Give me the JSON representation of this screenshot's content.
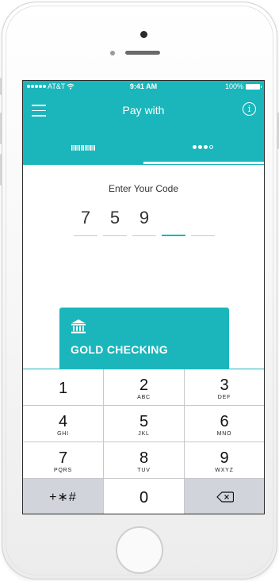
{
  "status_bar": {
    "carrier": "AT&T",
    "time": "9:41 AM",
    "battery": "100%"
  },
  "nav": {
    "title": "Pay with",
    "menu_icon": "hamburger-menu-icon",
    "info_icon": "info-icon",
    "info_glyph": "i"
  },
  "tabs": [
    {
      "icon": "barcode-icon",
      "selected": false
    },
    {
      "icon": "dots-code-icon",
      "selected": true
    }
  ],
  "code_entry": {
    "label": "Enter Your Code",
    "digits": [
      "7",
      "5",
      "9",
      "",
      ""
    ],
    "active_index": 3
  },
  "account": {
    "icon": "bank-icon",
    "name": "GOLD CHECKING"
  },
  "keypad": {
    "keys": [
      {
        "num": "1",
        "letters": ""
      },
      {
        "num": "2",
        "letters": "ABC"
      },
      {
        "num": "3",
        "letters": "DEF"
      },
      {
        "num": "4",
        "letters": "GHI"
      },
      {
        "num": "5",
        "letters": "JKL"
      },
      {
        "num": "6",
        "letters": "MNO"
      },
      {
        "num": "7",
        "letters": "PQRS"
      },
      {
        "num": "8",
        "letters": "TUV"
      },
      {
        "num": "9",
        "letters": "WXYZ"
      },
      {
        "num": "0",
        "letters": ""
      }
    ],
    "symbols_label": "+∗#",
    "backspace_icon": "backspace-icon"
  },
  "colors": {
    "accent": "#1ab6bb",
    "keypad_gray": "#d1d5db"
  }
}
